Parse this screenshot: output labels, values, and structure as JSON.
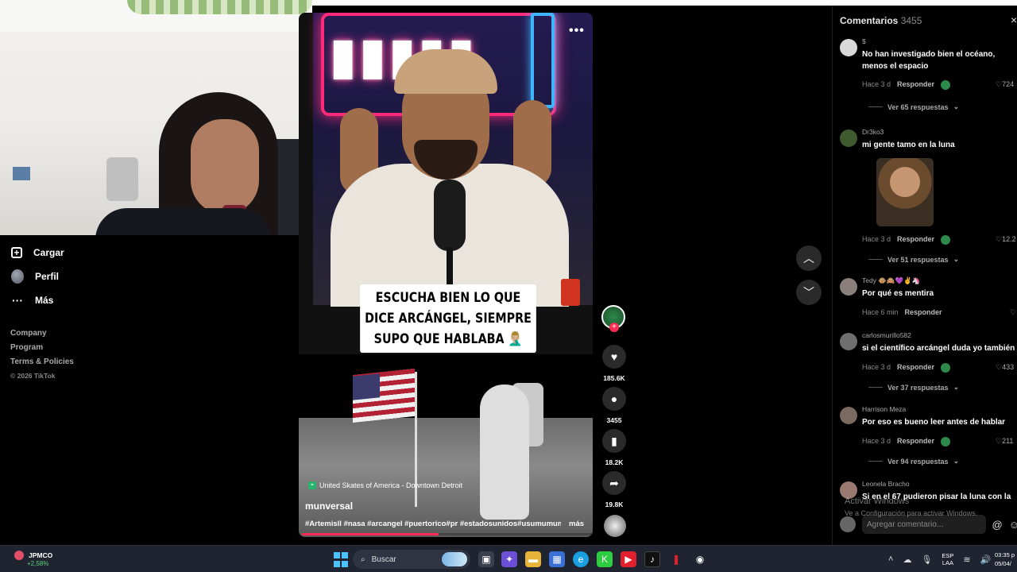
{
  "sidebar": {
    "items": [
      {
        "label": "Cargar",
        "icon": "upload-plus-icon"
      },
      {
        "label": "Perfil",
        "icon": "profile-avatar-icon"
      },
      {
        "label": "Más",
        "icon": "more-dots-icon"
      }
    ],
    "footer": [
      "Company",
      "Program",
      "Terms & Policies"
    ],
    "copyright": "© 2026 TikTok"
  },
  "video": {
    "caption": "ESCUCHA BIEN LO QUE DICE ARCÁNGEL, SIEMPRE SUPO QUE HABLABA 🤦🏼‍♂️",
    "location": "United Skates of America - Downtown Detroit",
    "author": "munversal",
    "tags": "#Artemisll #nasa #arcangel #puertorico#pr #estadosunidos#usumumum...",
    "more_label": "más",
    "progress_fraction": 0.47,
    "menu_icon": "more-horizontal-icon"
  },
  "actions": {
    "likes": "185.6K",
    "comments": "3455",
    "saves": "18.2K",
    "shares": "19.8K"
  },
  "comments_panel": {
    "title": "Comentarios",
    "count": "3455",
    "placeholder": "Agregar comentario...",
    "comments": [
      {
        "user": "$",
        "text": "No han investigado bien el océano, menos el espacio",
        "time": "Hace 3 d",
        "reply": "Responder",
        "likes": "724",
        "replies": "Ver 65 respuestas"
      },
      {
        "user": "Dr3ko3",
        "text": "mi gente tamo en la luna",
        "time": "Hace 3 d",
        "reply": "Responder",
        "likes": "12.2",
        "replies": "Ver 51 respuestas"
      },
      {
        "user": "Tedy 🐵🙈💜✌️🦄",
        "text": "Por qué es mentira",
        "time": "Hace 6 min",
        "reply": "Responder",
        "likes": "",
        "replies": ""
      },
      {
        "user": "carlosmurillo582",
        "text": "si el científico arcángel duda yo también",
        "time": "Hace 3 d",
        "reply": "Responder",
        "likes": "433",
        "replies": "Ver 37 respuestas"
      },
      {
        "user": "Harrison Meza",
        "text": "Por eso es bueno leer antes de hablar",
        "time": "Hace 3 d",
        "reply": "Responder",
        "likes": "211",
        "replies": "Ver 94 respuestas"
      },
      {
        "user": "Leonela Bracho",
        "text": "Si en el 67 pudieron pisar la luna con la",
        "time": "",
        "reply": "",
        "likes": "",
        "replies": ""
      }
    ]
  },
  "windows_activation": {
    "title": "Activar Windows",
    "subtitle": "Ve a Configuración para activar Windows."
  },
  "taskbar": {
    "stock_name": "JPMCO",
    "stock_change": "+2,58%",
    "search_label": "Buscar",
    "lang_top": "ESP",
    "lang_bottom": "LAA",
    "time": "03:35 p",
    "date": "05/04/"
  },
  "colors": {
    "accent": "#fe2c55",
    "background": "#000000",
    "taskbar": "#1f2430"
  }
}
